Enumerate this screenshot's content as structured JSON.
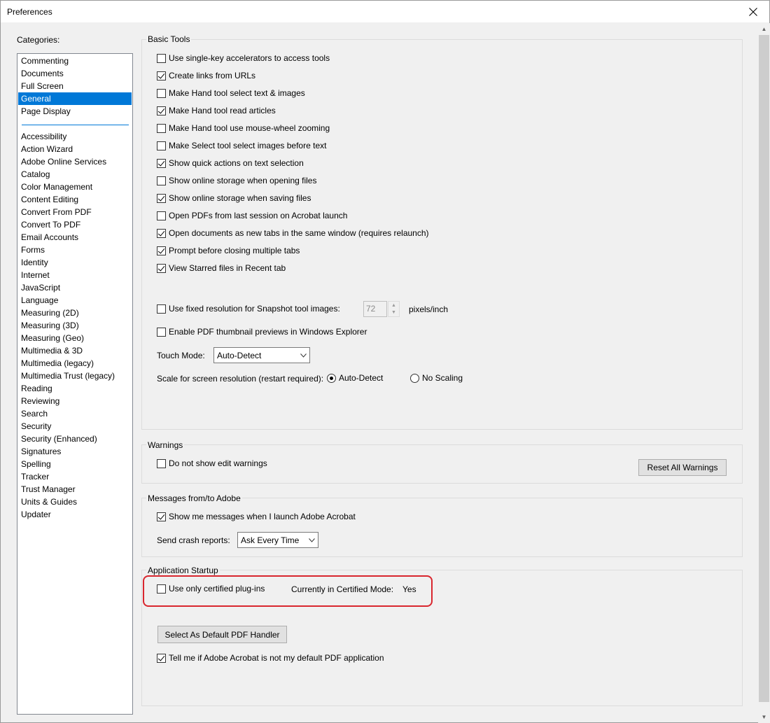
{
  "window": {
    "title": "Preferences",
    "close_glyph": "✕"
  },
  "categories": {
    "label": "Categories:",
    "top_items": [
      {
        "label": "Commenting",
        "selected": false
      },
      {
        "label": "Documents",
        "selected": false
      },
      {
        "label": "Full Screen",
        "selected": false
      },
      {
        "label": "General",
        "selected": true
      },
      {
        "label": "Page Display",
        "selected": false
      }
    ],
    "items": [
      "Accessibility",
      "Action Wizard",
      "Adobe Online Services",
      "Catalog",
      "Color Management",
      "Content Editing",
      "Convert From PDF",
      "Convert To PDF",
      "Email Accounts",
      "Forms",
      "Identity",
      "Internet",
      "JavaScript",
      "Language",
      "Measuring (2D)",
      "Measuring (3D)",
      "Measuring (Geo)",
      "Multimedia & 3D",
      "Multimedia (legacy)",
      "Multimedia Trust (legacy)",
      "Reading",
      "Reviewing",
      "Search",
      "Security",
      "Security (Enhanced)",
      "Signatures",
      "Spelling",
      "Tracker",
      "Trust Manager",
      "Units & Guides",
      "Updater"
    ]
  },
  "basic_tools": {
    "title": "Basic Tools",
    "options": [
      {
        "label": "Use single-key accelerators to access tools",
        "checked": false
      },
      {
        "label": "Create links from URLs",
        "checked": true
      },
      {
        "label": "Make Hand tool select text & images",
        "checked": false
      },
      {
        "label": "Make Hand tool read articles",
        "checked": true
      },
      {
        "label": "Make Hand tool use mouse-wheel zooming",
        "checked": false
      },
      {
        "label": "Make Select tool select images before text",
        "checked": false
      },
      {
        "label": "Show quick actions on text selection",
        "checked": true
      },
      {
        "label": "Show online storage when opening files",
        "checked": false
      },
      {
        "label": "Show online storage when saving files",
        "checked": true
      },
      {
        "label": "Open PDFs from last session on Acrobat launch",
        "checked": false
      },
      {
        "label": "Open documents as new tabs in the same window (requires relaunch)",
        "checked": true
      },
      {
        "label": "Prompt before closing multiple tabs",
        "checked": true
      },
      {
        "label": "View Starred files in Recent tab",
        "checked": true
      }
    ],
    "snapshot": {
      "label": "Use fixed resolution for Snapshot tool images:",
      "checked": false,
      "value": "72",
      "unit": "pixels/inch"
    },
    "thumbnail": {
      "label": "Enable PDF thumbnail previews in Windows Explorer",
      "checked": false
    },
    "touch_mode": {
      "label": "Touch Mode:",
      "value": "Auto-Detect"
    },
    "scale": {
      "label": "Scale for screen resolution (restart required):",
      "option_auto": "Auto-Detect",
      "option_none": "No Scaling",
      "selected": "auto"
    }
  },
  "warnings": {
    "title": "Warnings",
    "option": {
      "label": "Do not show edit warnings",
      "checked": false
    },
    "reset_button": "Reset All Warnings"
  },
  "messages": {
    "title": "Messages from/to Adobe",
    "option": {
      "label": "Show me messages when I launch Adobe Acrobat",
      "checked": true
    },
    "crash_label": "Send crash reports:",
    "crash_value": "Ask Every Time"
  },
  "startup": {
    "title": "Application Startup",
    "certified": {
      "label": "Use only certified plug-ins",
      "checked": false
    },
    "certified_mode_label": "Currently in Certified Mode:",
    "certified_mode_value": "Yes",
    "default_handler_button": "Select As Default PDF Handler",
    "tell_me": {
      "label": "Tell me if Adobe Acrobat is not my default PDF application",
      "checked": true
    }
  },
  "colors": {
    "selection": "#0078d7",
    "highlight": "#d9262e"
  }
}
